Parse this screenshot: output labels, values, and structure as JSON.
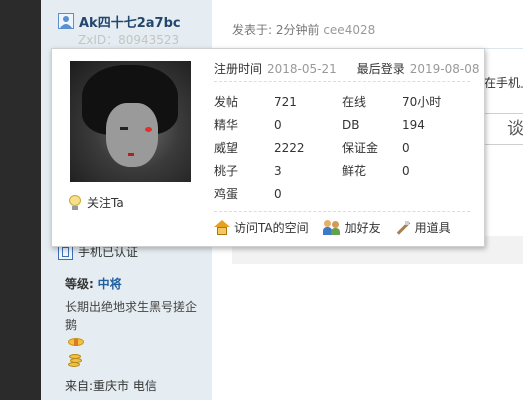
{
  "author": {
    "username": "Ak四十七2a7bc",
    "zxid": "ZxID：80943523",
    "verified_label": "手机已认证",
    "level_label": "等级:",
    "level_value": "中将",
    "signature": "长期出绝地求生黑号搓企鹅",
    "from": "来自:重庆市 电信"
  },
  "post": {
    "meta_prefix": "发表于: 2分钟前",
    "meta_user": "cee4028",
    "snippet": "在手机上",
    "box_text": "谈"
  },
  "popup": {
    "follow_label": "关注Ta",
    "register_label": "注册时间",
    "register_date": "2018-05-21",
    "last_login_label": "最后登录",
    "last_login_date": "2019-08-08",
    "stats": [
      {
        "k1": "发帖",
        "v1": "721",
        "k2": "在线",
        "v2": "70小时"
      },
      {
        "k1": "精华",
        "v1": "0",
        "k2": "DB",
        "v2": "194"
      },
      {
        "k1": "威望",
        "v1": "2222",
        "k2": "保证金",
        "v2": "0"
      },
      {
        "k1": "桃子",
        "v1": "3",
        "k2": "鲜花",
        "v2": "0"
      },
      {
        "k1": "鸡蛋",
        "v1": "0",
        "k2": "",
        "v2": ""
      }
    ],
    "actions": {
      "space_label": "访问TA的空间",
      "add_friend_label": "加好友",
      "tools_label": "用道具"
    }
  }
}
